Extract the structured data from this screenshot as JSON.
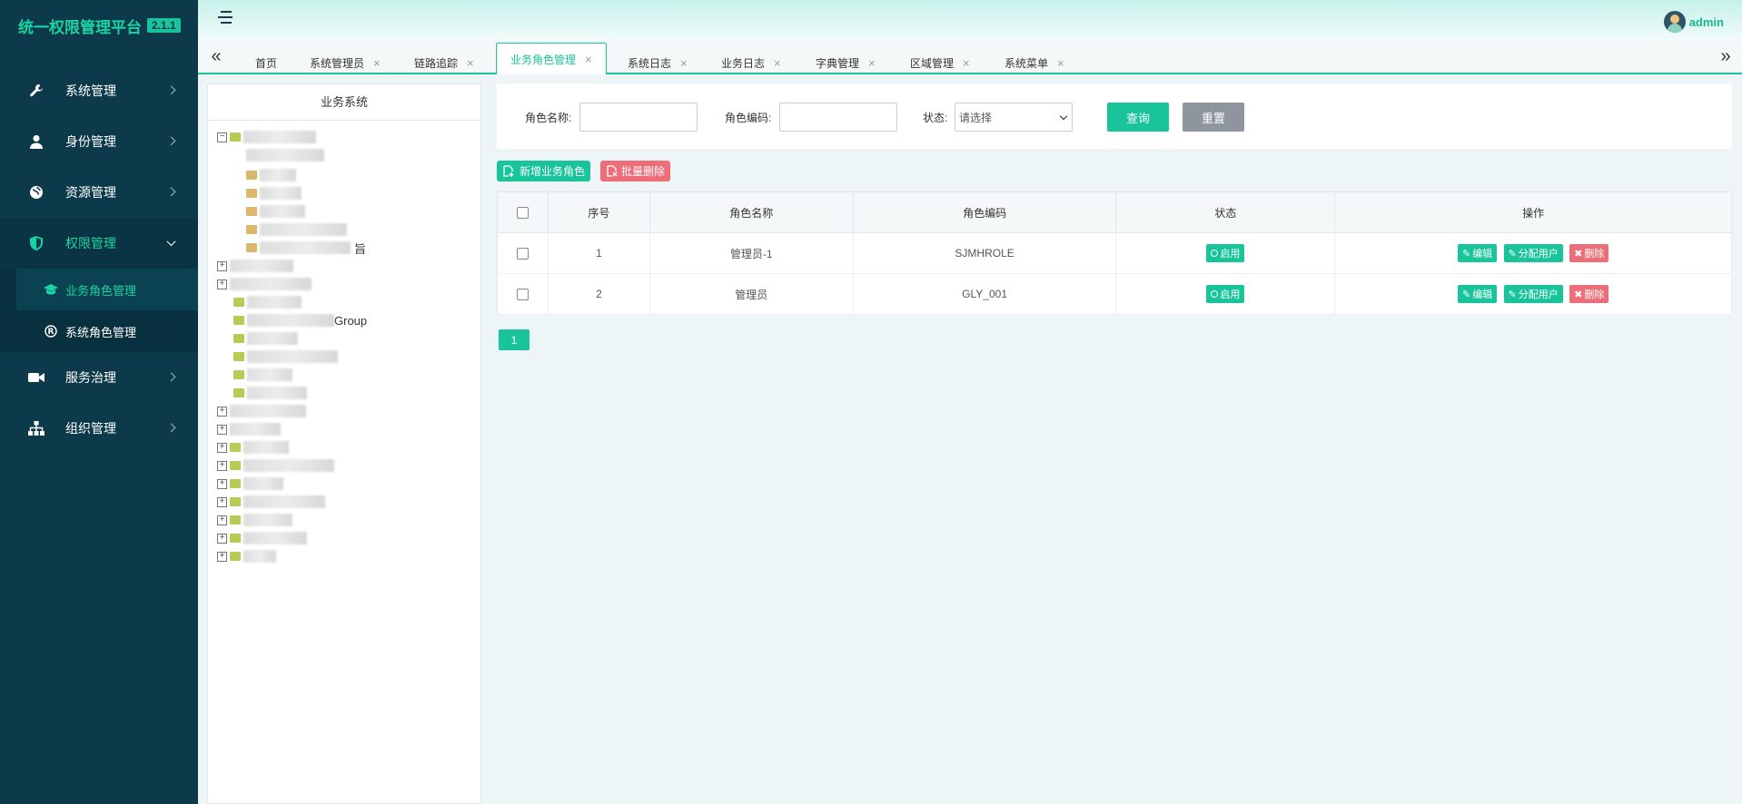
{
  "app": {
    "title": "统一权限管理平台",
    "version": "2.1.1"
  },
  "user": {
    "name": "admin"
  },
  "sidebar": {
    "items": [
      {
        "label": "系统管理",
        "icon": "wrench-icon"
      },
      {
        "label": "身份管理",
        "icon": "user-icon"
      },
      {
        "label": "资源管理",
        "icon": "globe-icon"
      },
      {
        "label": "权限管理",
        "icon": "shield-icon",
        "active": true
      },
      {
        "label": "服务治理",
        "icon": "video-icon"
      },
      {
        "label": "组织管理",
        "icon": "sitemap-icon"
      }
    ],
    "sub_items": [
      {
        "label": "业务角色管理",
        "icon": "graduation-cap-icon",
        "active": true
      },
      {
        "label": "系统角色管理",
        "icon": "registered-icon"
      }
    ]
  },
  "tabs": [
    {
      "label": "首页",
      "closable": false
    },
    {
      "label": "系统管理员",
      "closable": true
    },
    {
      "label": "链路追踪",
      "closable": true
    },
    {
      "label": "业务角色管理",
      "closable": true,
      "active": true
    },
    {
      "label": "系统日志",
      "closable": true
    },
    {
      "label": "业务日志",
      "closable": true
    },
    {
      "label": "字典管理",
      "closable": true
    },
    {
      "label": "区域管理",
      "closable": true
    },
    {
      "label": "系统菜单",
      "closable": true
    }
  ],
  "tree": {
    "title": "业务系统",
    "visible_fragment_group": "Group",
    "visible_fragment_jiu": "旨"
  },
  "search": {
    "role_name_label": "角色名称:",
    "role_name_value": "",
    "role_code_label": "角色编码:",
    "role_code_value": "",
    "status_label": "状态:",
    "status_selected": "请选择",
    "query_button": "查询",
    "reset_button": "重置"
  },
  "toolbar": {
    "add_button": "新增业务角色",
    "batch_delete_button": "批量删除"
  },
  "table": {
    "columns": [
      "序号",
      "角色名称",
      "角色编码",
      "状态",
      "操作"
    ],
    "rows": [
      {
        "index": "1",
        "name": "管理员-1",
        "code": "SJMHROLE",
        "status": "启用"
      },
      {
        "index": "2",
        "name": "管理员",
        "code": "GLY_001",
        "status": "启用"
      }
    ],
    "actions": {
      "edit": "编辑",
      "assign": "分配用户",
      "delete": "删除"
    }
  },
  "pagination": {
    "current_page": "1"
  },
  "colors": {
    "accent": "#19c49a",
    "sidebar": "#0c3a4a",
    "danger": "#ed6d79",
    "neutral": "#8e959c"
  }
}
